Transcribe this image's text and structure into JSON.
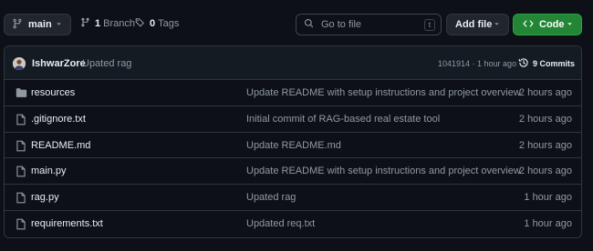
{
  "toolbar": {
    "branch_label": "main",
    "branch_count": "1",
    "branch_text": "Branch",
    "tag_count": "0",
    "tag_text": "Tags",
    "search_placeholder": "Go to file",
    "search_shortcut": "t",
    "add_file_label": "Add file",
    "code_label": "Code"
  },
  "commit": {
    "author": "IshwarZore",
    "message": "Upated rag",
    "hash_time": "1041914 · 1 hour ago",
    "commits_label": "9 Commits"
  },
  "files": [
    {
      "name": "resources",
      "type": "folder",
      "message": "Update README with setup instructions and project overview",
      "time": "2 hours ago"
    },
    {
      "name": ".gitignore.txt",
      "type": "file",
      "message": "Initial commit of RAG-based real estate tool",
      "time": "2 hours ago"
    },
    {
      "name": "README.md",
      "type": "file",
      "message": "Update README.md",
      "time": "2 hours ago"
    },
    {
      "name": "main.py",
      "type": "file",
      "message": "Update README with setup instructions and project overview",
      "time": "2 hours ago"
    },
    {
      "name": "rag.py",
      "type": "file",
      "message": "Upated rag",
      "time": "1 hour ago"
    },
    {
      "name": "requirements.txt",
      "type": "file",
      "message": "Updated req.txt",
      "time": "1 hour ago"
    }
  ],
  "icons": {
    "branch": "git-branch-icon",
    "tag": "tag-icon",
    "search": "search-icon",
    "code": "code-icon",
    "history": "history-icon",
    "folder": "folder-icon",
    "file": "file-icon"
  },
  "colors": {
    "background": "#0d1117",
    "code_button": "#238636",
    "muted_text": "#9198a1"
  }
}
